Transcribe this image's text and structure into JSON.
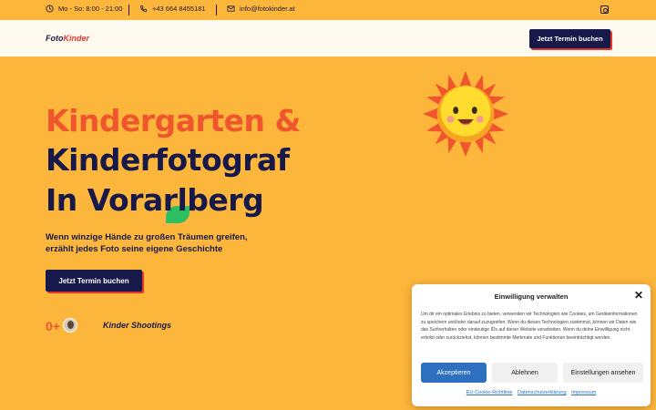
{
  "topbar": {
    "hours": "Mo - So: 8:00 - 21:00",
    "phone": "+43 664 8455181",
    "email": "info@fotokinder.at"
  },
  "nav": {
    "logo_part1": "Foto",
    "logo_part2": "Kinder",
    "cta": "Jetzt Termin buchen"
  },
  "hero": {
    "line1": "Kindergarten &",
    "line2": "Kinderfotograf",
    "line3": "In Vorarlberg",
    "subtitle": "Wenn winzige Hände zu großen Träumen greifen, erzählt jedes Foto seine eigene Geschichte",
    "cta": "Jetzt Termin buchen",
    "count": "0+",
    "count_label": "Kinder Shootings"
  },
  "consent": {
    "title": "Einwilligung verwalten",
    "body": "Um dir ein optimales Erlebnis zu bieten, verwenden wir Technologien wie Cookies, um Geräteinformationen zu speichern und/oder darauf zuzugreifen. Wenn du diesen Technologien zustimmst, können wir Daten wie das Surfverhalten oder eindeutige IDs auf dieser Website verarbeiten. Wenn du deine Einwilligung nicht erteilst oder zurückziehst, können bestimmte Merkmale und Funktionen beeinträchtigt werden.",
    "accept": "Akzeptieren",
    "deny": "Ablehnen",
    "preferences": "Einstellungen ansehen",
    "link1": "EU-Cookie-Richtlinie",
    "link2": "Datenschutzerklärung",
    "link3": "Impressum"
  },
  "colors": {
    "background": "#fdb63c",
    "navy": "#16194a",
    "accent": "#f0562e",
    "consent_blue": "#2f6fbf"
  }
}
